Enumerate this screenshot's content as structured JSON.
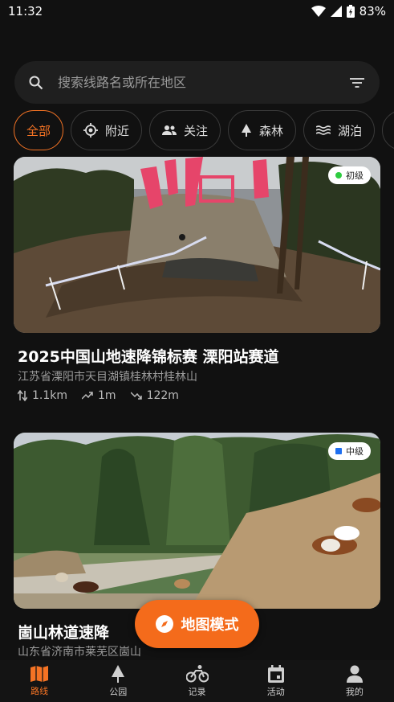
{
  "status_bar": {
    "time": "11:32",
    "battery": "83%"
  },
  "search": {
    "placeholder": "搜索线路名或所在地区"
  },
  "filters": [
    {
      "label": "全部",
      "icon": "none",
      "active": true
    },
    {
      "label": "附近",
      "icon": "location-target-icon"
    },
    {
      "label": "关注",
      "icon": "people-icon"
    },
    {
      "label": "森林",
      "icon": "tree-icon"
    },
    {
      "label": "湖泊",
      "icon": "water-icon"
    },
    {
      "label": "",
      "icon": "mountain-icon"
    }
  ],
  "routes": [
    {
      "difficulty": "初级",
      "difficulty_color": "#2ecc40",
      "title": "2025中国山地速降锦标赛 溧阳站赛道",
      "location": "江苏省溧阳市天目湖镇桂林村桂林山",
      "distance": "1.1km",
      "ascent": "1m",
      "descent": "122m"
    },
    {
      "difficulty": "中级",
      "difficulty_color": "#1e6ff0",
      "title": "崮山林道速降",
      "location": "山东省济南市莱芜区崮山"
    }
  ],
  "fab": {
    "label": "地图模式"
  },
  "nav": [
    {
      "label": "路线",
      "icon": "map-icon",
      "active": true
    },
    {
      "label": "公园",
      "icon": "tree-icon"
    },
    {
      "label": "记录",
      "icon": "bike-icon"
    },
    {
      "label": "活动",
      "icon": "calendar-icon"
    },
    {
      "label": "我的",
      "icon": "person-icon"
    }
  ],
  "colors": {
    "accent": "#f47324",
    "background": "#111111",
    "surface": "#1f1f1f"
  }
}
